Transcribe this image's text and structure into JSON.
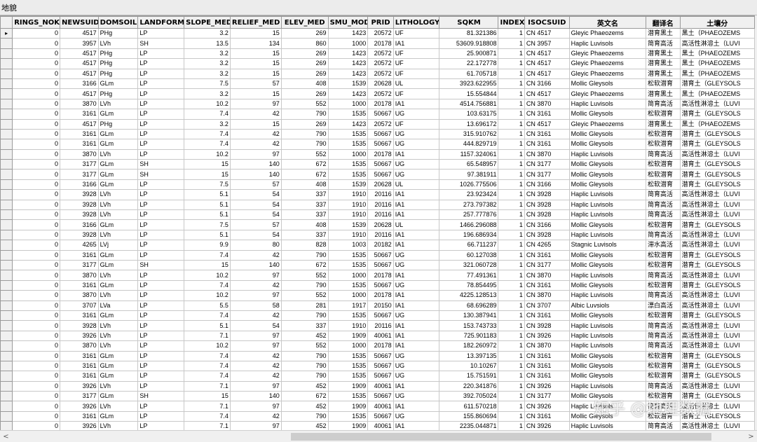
{
  "window": {
    "title": "地貌"
  },
  "columns": [
    {
      "name": "",
      "align": "c"
    },
    {
      "name": "RINGS_NOK",
      "align": "r"
    },
    {
      "name": "NEWSUID",
      "align": "r"
    },
    {
      "name": "DOMSOIL",
      "align": "l"
    },
    {
      "name": "LANDFORM",
      "align": "l"
    },
    {
      "name": "SLOPE_MED",
      "align": "r"
    },
    {
      "name": "RELIEF_MED",
      "align": "r"
    },
    {
      "name": "ELEV_MED",
      "align": "r"
    },
    {
      "name": "SMU_MOD",
      "align": "r"
    },
    {
      "name": "PRID",
      "align": "r"
    },
    {
      "name": "LITHOLOGY",
      "align": "l"
    },
    {
      "name": "SQKM",
      "align": "r"
    },
    {
      "name": "INDEX",
      "align": "r"
    },
    {
      "name": "ISOCSUID",
      "align": "l"
    },
    {
      "name": "英文名",
      "align": "l"
    },
    {
      "name": "翻译名",
      "align": "l"
    },
    {
      "name": "土壤分",
      "align": "l"
    }
  ],
  "rows": [
    [
      "▸",
      "0",
      "4517",
      "PHg",
      "LP",
      "3.2",
      "15",
      "269",
      "1423",
      "20572",
      "UF",
      "81.321386",
      "1",
      "CN 4517",
      "Gleyic Phaeozems",
      "潜育黑土",
      "黑土（PHAEOZEMS"
    ],
    [
      "",
      "0",
      "3957",
      "LVh",
      "SH",
      "13.5",
      "134",
      "860",
      "1000",
      "20178",
      "IA1",
      "53609.918808",
      "1",
      "CN 3957",
      "Haplic Luvisols",
      "简育高活",
      "高活性淋溶土（LUVI"
    ],
    [
      "",
      "0",
      "4517",
      "PHg",
      "LP",
      "3.2",
      "15",
      "269",
      "1423",
      "20572",
      "UF",
      "25.900871",
      "1",
      "CN 4517",
      "Gleyic Phaeozems",
      "潜育黑土",
      "黑土（PHAEOZEMS"
    ],
    [
      "",
      "0",
      "4517",
      "PHg",
      "LP",
      "3.2",
      "15",
      "269",
      "1423",
      "20572",
      "UF",
      "22.172778",
      "1",
      "CN 4517",
      "Gleyic Phaeozems",
      "潜育黑土",
      "黑土（PHAEOZEMS"
    ],
    [
      "",
      "0",
      "4517",
      "PHg",
      "LP",
      "3.2",
      "15",
      "269",
      "1423",
      "20572",
      "UF",
      "61.705718",
      "1",
      "CN 4517",
      "Gleyic Phaeozems",
      "潜育黑土",
      "黑土（PHAEOZEMS"
    ],
    [
      "",
      "0",
      "3166",
      "GLm",
      "LP",
      "7.5",
      "57",
      "408",
      "1539",
      "20628",
      "UL",
      "3923.622955",
      "1",
      "CN 3166",
      "Mollic Gleysols",
      "松软潜育",
      "潜育土（GLEYSOLS"
    ],
    [
      "",
      "0",
      "4517",
      "PHg",
      "LP",
      "3.2",
      "15",
      "269",
      "1423",
      "20572",
      "UF",
      "15.554844",
      "1",
      "CN 4517",
      "Gleyic Phaeozems",
      "潜育黑土",
      "黑土（PHAEOZEMS"
    ],
    [
      "",
      "0",
      "3870",
      "LVh",
      "LP",
      "10.2",
      "97",
      "552",
      "1000",
      "20178",
      "IA1",
      "4514.756881",
      "1",
      "CN 3870",
      "Haplic Luvisols",
      "简育高活",
      "高活性淋溶土（LUVI"
    ],
    [
      "",
      "0",
      "3161",
      "GLm",
      "LP",
      "7.4",
      "42",
      "790",
      "1535",
      "50667",
      "UG",
      "103.63175",
      "1",
      "CN 3161",
      "Mollic Gleysols",
      "松软潜育",
      "潜育土（GLEYSOLS"
    ],
    [
      "",
      "0",
      "4517",
      "PHg",
      "LP",
      "3.2",
      "15",
      "269",
      "1423",
      "20572",
      "UF",
      "13.696172",
      "1",
      "CN 4517",
      "Gleyic Phaeozems",
      "潜育黑土",
      "黑土（PHAEOZEMS"
    ],
    [
      "",
      "0",
      "3161",
      "GLm",
      "LP",
      "7.4",
      "42",
      "790",
      "1535",
      "50667",
      "UG",
      "315.910762",
      "1",
      "CN 3161",
      "Mollic Gleysols",
      "松软潜育",
      "潜育土（GLEYSOLS"
    ],
    [
      "",
      "0",
      "3161",
      "GLm",
      "LP",
      "7.4",
      "42",
      "790",
      "1535",
      "50667",
      "UG",
      "444.829719",
      "1",
      "CN 3161",
      "Mollic Gleysols",
      "松软潜育",
      "潜育土（GLEYSOLS"
    ],
    [
      "",
      "0",
      "3870",
      "LVh",
      "LP",
      "10.2",
      "97",
      "552",
      "1000",
      "20178",
      "IA1",
      "1157.324061",
      "1",
      "CN 3870",
      "Haplic Luvisols",
      "简育高活",
      "高活性淋溶土（LUVI"
    ],
    [
      "",
      "0",
      "3177",
      "GLm",
      "SH",
      "15",
      "140",
      "672",
      "1535",
      "50667",
      "UG",
      "65.548957",
      "1",
      "CN 3177",
      "Mollic Gleysols",
      "松软潜育",
      "潜育土（GLEYSOLS"
    ],
    [
      "",
      "0",
      "3177",
      "GLm",
      "SH",
      "15",
      "140",
      "672",
      "1535",
      "50667",
      "UG",
      "97.381911",
      "1",
      "CN 3177",
      "Mollic Gleysols",
      "松软潜育",
      "潜育土（GLEYSOLS"
    ],
    [
      "",
      "0",
      "3166",
      "GLm",
      "LP",
      "7.5",
      "57",
      "408",
      "1539",
      "20628",
      "UL",
      "1026.775506",
      "1",
      "CN 3166",
      "Mollic Gleysols",
      "松软潜育",
      "潜育土（GLEYSOLS"
    ],
    [
      "",
      "0",
      "3928",
      "LVh",
      "LP",
      "5.1",
      "54",
      "337",
      "1910",
      "20116",
      "IA1",
      "23.923424",
      "1",
      "CN 3928",
      "Haplic Luvisols",
      "简育高活",
      "高活性淋溶土（LUVI"
    ],
    [
      "",
      "0",
      "3928",
      "LVh",
      "LP",
      "5.1",
      "54",
      "337",
      "1910",
      "20116",
      "IA1",
      "273.797382",
      "1",
      "CN 3928",
      "Haplic Luvisols",
      "简育高活",
      "高活性淋溶土（LUVI"
    ],
    [
      "",
      "0",
      "3928",
      "LVh",
      "LP",
      "5.1",
      "54",
      "337",
      "1910",
      "20116",
      "IA1",
      "257.777876",
      "1",
      "CN 3928",
      "Haplic Luvisols",
      "简育高活",
      "高活性淋溶土（LUVI"
    ],
    [
      "",
      "0",
      "3166",
      "GLm",
      "LP",
      "7.5",
      "57",
      "408",
      "1539",
      "20628",
      "UL",
      "1466.296088",
      "1",
      "CN 3166",
      "Mollic Gleysols",
      "松软潜育",
      "潜育土（GLEYSOLS"
    ],
    [
      "",
      "0",
      "3928",
      "LVh",
      "LP",
      "5.1",
      "54",
      "337",
      "1910",
      "20116",
      "IA1",
      "196.686934",
      "1",
      "CN 3928",
      "Haplic Luvisols",
      "简育高活",
      "高活性淋溶土（LUVI"
    ],
    [
      "",
      "0",
      "4265",
      "LVj",
      "LP",
      "9.9",
      "80",
      "828",
      "1003",
      "20182",
      "IA1",
      "66.711237",
      "1",
      "CN 4265",
      "Stagnic Luvisols",
      "滞水高活",
      "高活性淋溶土（LUVI"
    ],
    [
      "",
      "0",
      "3161",
      "GLm",
      "LP",
      "7.4",
      "42",
      "790",
      "1535",
      "50667",
      "UG",
      "60.127038",
      "1",
      "CN 3161",
      "Mollic Gleysols",
      "松软潜育",
      "潜育土（GLEYSOLS"
    ],
    [
      "",
      "0",
      "3177",
      "GLm",
      "SH",
      "15",
      "140",
      "672",
      "1535",
      "50667",
      "UG",
      "321.060728",
      "1",
      "CN 3177",
      "Mollic Gleysols",
      "松软潜育",
      "潜育土（GLEYSOLS"
    ],
    [
      "",
      "0",
      "3870",
      "LVh",
      "LP",
      "10.2",
      "97",
      "552",
      "1000",
      "20178",
      "IA1",
      "77.491361",
      "1",
      "CN 3870",
      "Haplic Luvisols",
      "简育高活",
      "高活性淋溶土（LUVI"
    ],
    [
      "",
      "0",
      "3161",
      "GLm",
      "LP",
      "7.4",
      "42",
      "790",
      "1535",
      "50667",
      "UG",
      "78.854495",
      "1",
      "CN 3161",
      "Mollic Gleysols",
      "松软潜育",
      "潜育土（GLEYSOLS"
    ],
    [
      "",
      "0",
      "3870",
      "LVh",
      "LP",
      "10.2",
      "97",
      "552",
      "1000",
      "20178",
      "IA1",
      "4225.128513",
      "1",
      "CN 3870",
      "Haplic Luvisols",
      "简育高活",
      "高活性淋溶土（LUVI"
    ],
    [
      "",
      "0",
      "3707",
      "LVa",
      "LP",
      "5.5",
      "58",
      "281",
      "1917",
      "20150",
      "IA1",
      "68.696289",
      "1",
      "CN 3707",
      "Albic Luvsiols",
      "漂白高活",
      "高活性淋溶土（LUVI"
    ],
    [
      "",
      "0",
      "3161",
      "GLm",
      "LP",
      "7.4",
      "42",
      "790",
      "1535",
      "50667",
      "UG",
      "130.387941",
      "1",
      "CN 3161",
      "Mollic Gleysols",
      "松软潜育",
      "潜育土（GLEYSOLS"
    ],
    [
      "",
      "0",
      "3928",
      "LVh",
      "LP",
      "5.1",
      "54",
      "337",
      "1910",
      "20116",
      "IA1",
      "153.743733",
      "1",
      "CN 3928",
      "Haplic Luvisols",
      "简育高活",
      "高活性淋溶土（LUVI"
    ],
    [
      "",
      "0",
      "3926",
      "LVh",
      "LP",
      "7.1",
      "97",
      "452",
      "1909",
      "40061",
      "IA1",
      "725.901183",
      "1",
      "CN 3926",
      "Haplic Luvisols",
      "简育高活",
      "高活性淋溶土（LUVI"
    ],
    [
      "",
      "0",
      "3870",
      "LVh",
      "LP",
      "10.2",
      "97",
      "552",
      "1000",
      "20178",
      "IA1",
      "182.260972",
      "1",
      "CN 3870",
      "Haplic Luvisols",
      "简育高活",
      "高活性淋溶土（LUVI"
    ],
    [
      "",
      "0",
      "3161",
      "GLm",
      "LP",
      "7.4",
      "42",
      "790",
      "1535",
      "50667",
      "UG",
      "13.397135",
      "1",
      "CN 3161",
      "Mollic Gleysols",
      "松软潜育",
      "潜育土（GLEYSOLS"
    ],
    [
      "",
      "0",
      "3161",
      "GLm",
      "LP",
      "7.4",
      "42",
      "790",
      "1535",
      "50667",
      "UG",
      "10.10267",
      "1",
      "CN 3161",
      "Mollic Gleysols",
      "松软潜育",
      "潜育土（GLEYSOLS"
    ],
    [
      "",
      "0",
      "3161",
      "GLm",
      "LP",
      "7.4",
      "42",
      "790",
      "1535",
      "50667",
      "UG",
      "15.751591",
      "1",
      "CN 3161",
      "Mollic Gleysols",
      "松软潜育",
      "潜育土（GLEYSOLS"
    ],
    [
      "",
      "0",
      "3926",
      "LVh",
      "LP",
      "7.1",
      "97",
      "452",
      "1909",
      "40061",
      "IA1",
      "220.341876",
      "1",
      "CN 3926",
      "Haplic Luvisols",
      "简育高活",
      "高活性淋溶土（LUVI"
    ],
    [
      "",
      "0",
      "3177",
      "GLm",
      "SH",
      "15",
      "140",
      "672",
      "1535",
      "50667",
      "UG",
      "392.705024",
      "1",
      "CN 3177",
      "Mollic Gleysols",
      "松软潜育",
      "潜育土（GLEYSOLS"
    ],
    [
      "",
      "0",
      "3926",
      "LVh",
      "LP",
      "7.1",
      "97",
      "452",
      "1909",
      "40061",
      "IA1",
      "611.570218",
      "1",
      "CN 3926",
      "Haplic Luvisols",
      "简育高活",
      "高活性淋溶土（LUVI"
    ],
    [
      "",
      "0",
      "3161",
      "GLm",
      "LP",
      "7.4",
      "42",
      "790",
      "1535",
      "50667",
      "UG",
      "155.860694",
      "1",
      "CN 3161",
      "Mollic Gleysols",
      "松软潜育",
      "潜育土（GLEYSOLS"
    ],
    [
      "",
      "0",
      "3926",
      "LVh",
      "LP",
      "7.1",
      "97",
      "452",
      "1909",
      "40061",
      "IA1",
      "2235.044871",
      "1",
      "CN 3926",
      "Haplic Luvisols",
      "简育高活",
      "高活性淋溶土（LUVI"
    ]
  ],
  "scrollbar": {
    "left_arrow": "<",
    "right_arrow": ">"
  },
  "watermark": {
    "text": "知乎 @地理数据"
  }
}
